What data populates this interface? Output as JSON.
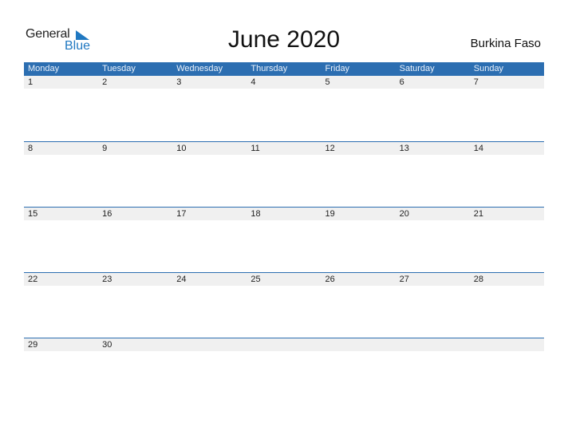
{
  "logo": {
    "word1": "General",
    "word2": "Blue"
  },
  "title": "June 2020",
  "country": "Burkina Faso",
  "colors": {
    "header": "#2c6eb1",
    "row": "#f0f0f0",
    "brand": "#1f78c1"
  },
  "weekdays": [
    "Monday",
    "Tuesday",
    "Wednesday",
    "Thursday",
    "Friday",
    "Saturday",
    "Sunday"
  ],
  "weeks": [
    [
      "1",
      "2",
      "3",
      "4",
      "5",
      "6",
      "7"
    ],
    [
      "8",
      "9",
      "10",
      "11",
      "12",
      "13",
      "14"
    ],
    [
      "15",
      "16",
      "17",
      "18",
      "19",
      "20",
      "21"
    ],
    [
      "22",
      "23",
      "24",
      "25",
      "26",
      "27",
      "28"
    ],
    [
      "29",
      "30",
      "",
      "",
      "",
      "",
      ""
    ]
  ]
}
